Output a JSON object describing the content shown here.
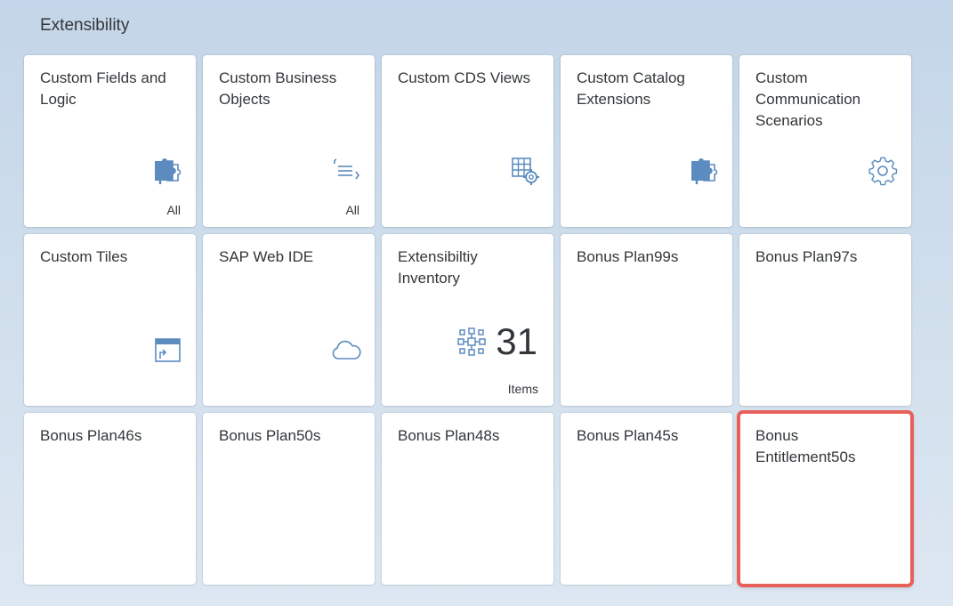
{
  "section": {
    "title": "Extensibility"
  },
  "tiles": [
    {
      "title": "Custom Fields and\nLogic",
      "footer": "All",
      "icon": "puzzle-icon"
    },
    {
      "title": "Custom Business\nObjects",
      "footer": "All",
      "icon": "list-expand-icon"
    },
    {
      "title": "Custom CDS Views",
      "footer": "",
      "icon": "table-settings-icon"
    },
    {
      "title": "Custom Catalog\nExtensions",
      "footer": "",
      "icon": "puzzle-icon"
    },
    {
      "title": "Custom\nCommunication\nScenarios",
      "footer": "",
      "icon": "gear-icon"
    },
    {
      "title": "Custom Tiles",
      "footer": "",
      "icon": "tile-launch-icon"
    },
    {
      "title": "SAP Web IDE",
      "footer": "",
      "icon": "cloud-icon"
    },
    {
      "title": "Extensibiltiy\nInventory",
      "kpi_value": "31",
      "footer": "Items",
      "icon": "network-icon"
    },
    {
      "title": "Bonus Plan99s",
      "footer": "",
      "icon": ""
    },
    {
      "title": "Bonus Plan97s",
      "footer": "",
      "icon": ""
    },
    {
      "title": "Bonus Plan46s",
      "footer": "",
      "icon": ""
    },
    {
      "title": "Bonus Plan50s",
      "footer": "",
      "icon": ""
    },
    {
      "title": "Bonus Plan48s",
      "footer": "",
      "icon": ""
    },
    {
      "title": "Bonus Plan45s",
      "footer": "",
      "icon": ""
    },
    {
      "title": "Bonus\nEntitlement50s",
      "footer": "",
      "icon": "",
      "highlighted": true
    }
  ],
  "colors": {
    "icon": "#5b8bbf",
    "highlight": "#e8605a",
    "text": "#32363a"
  }
}
